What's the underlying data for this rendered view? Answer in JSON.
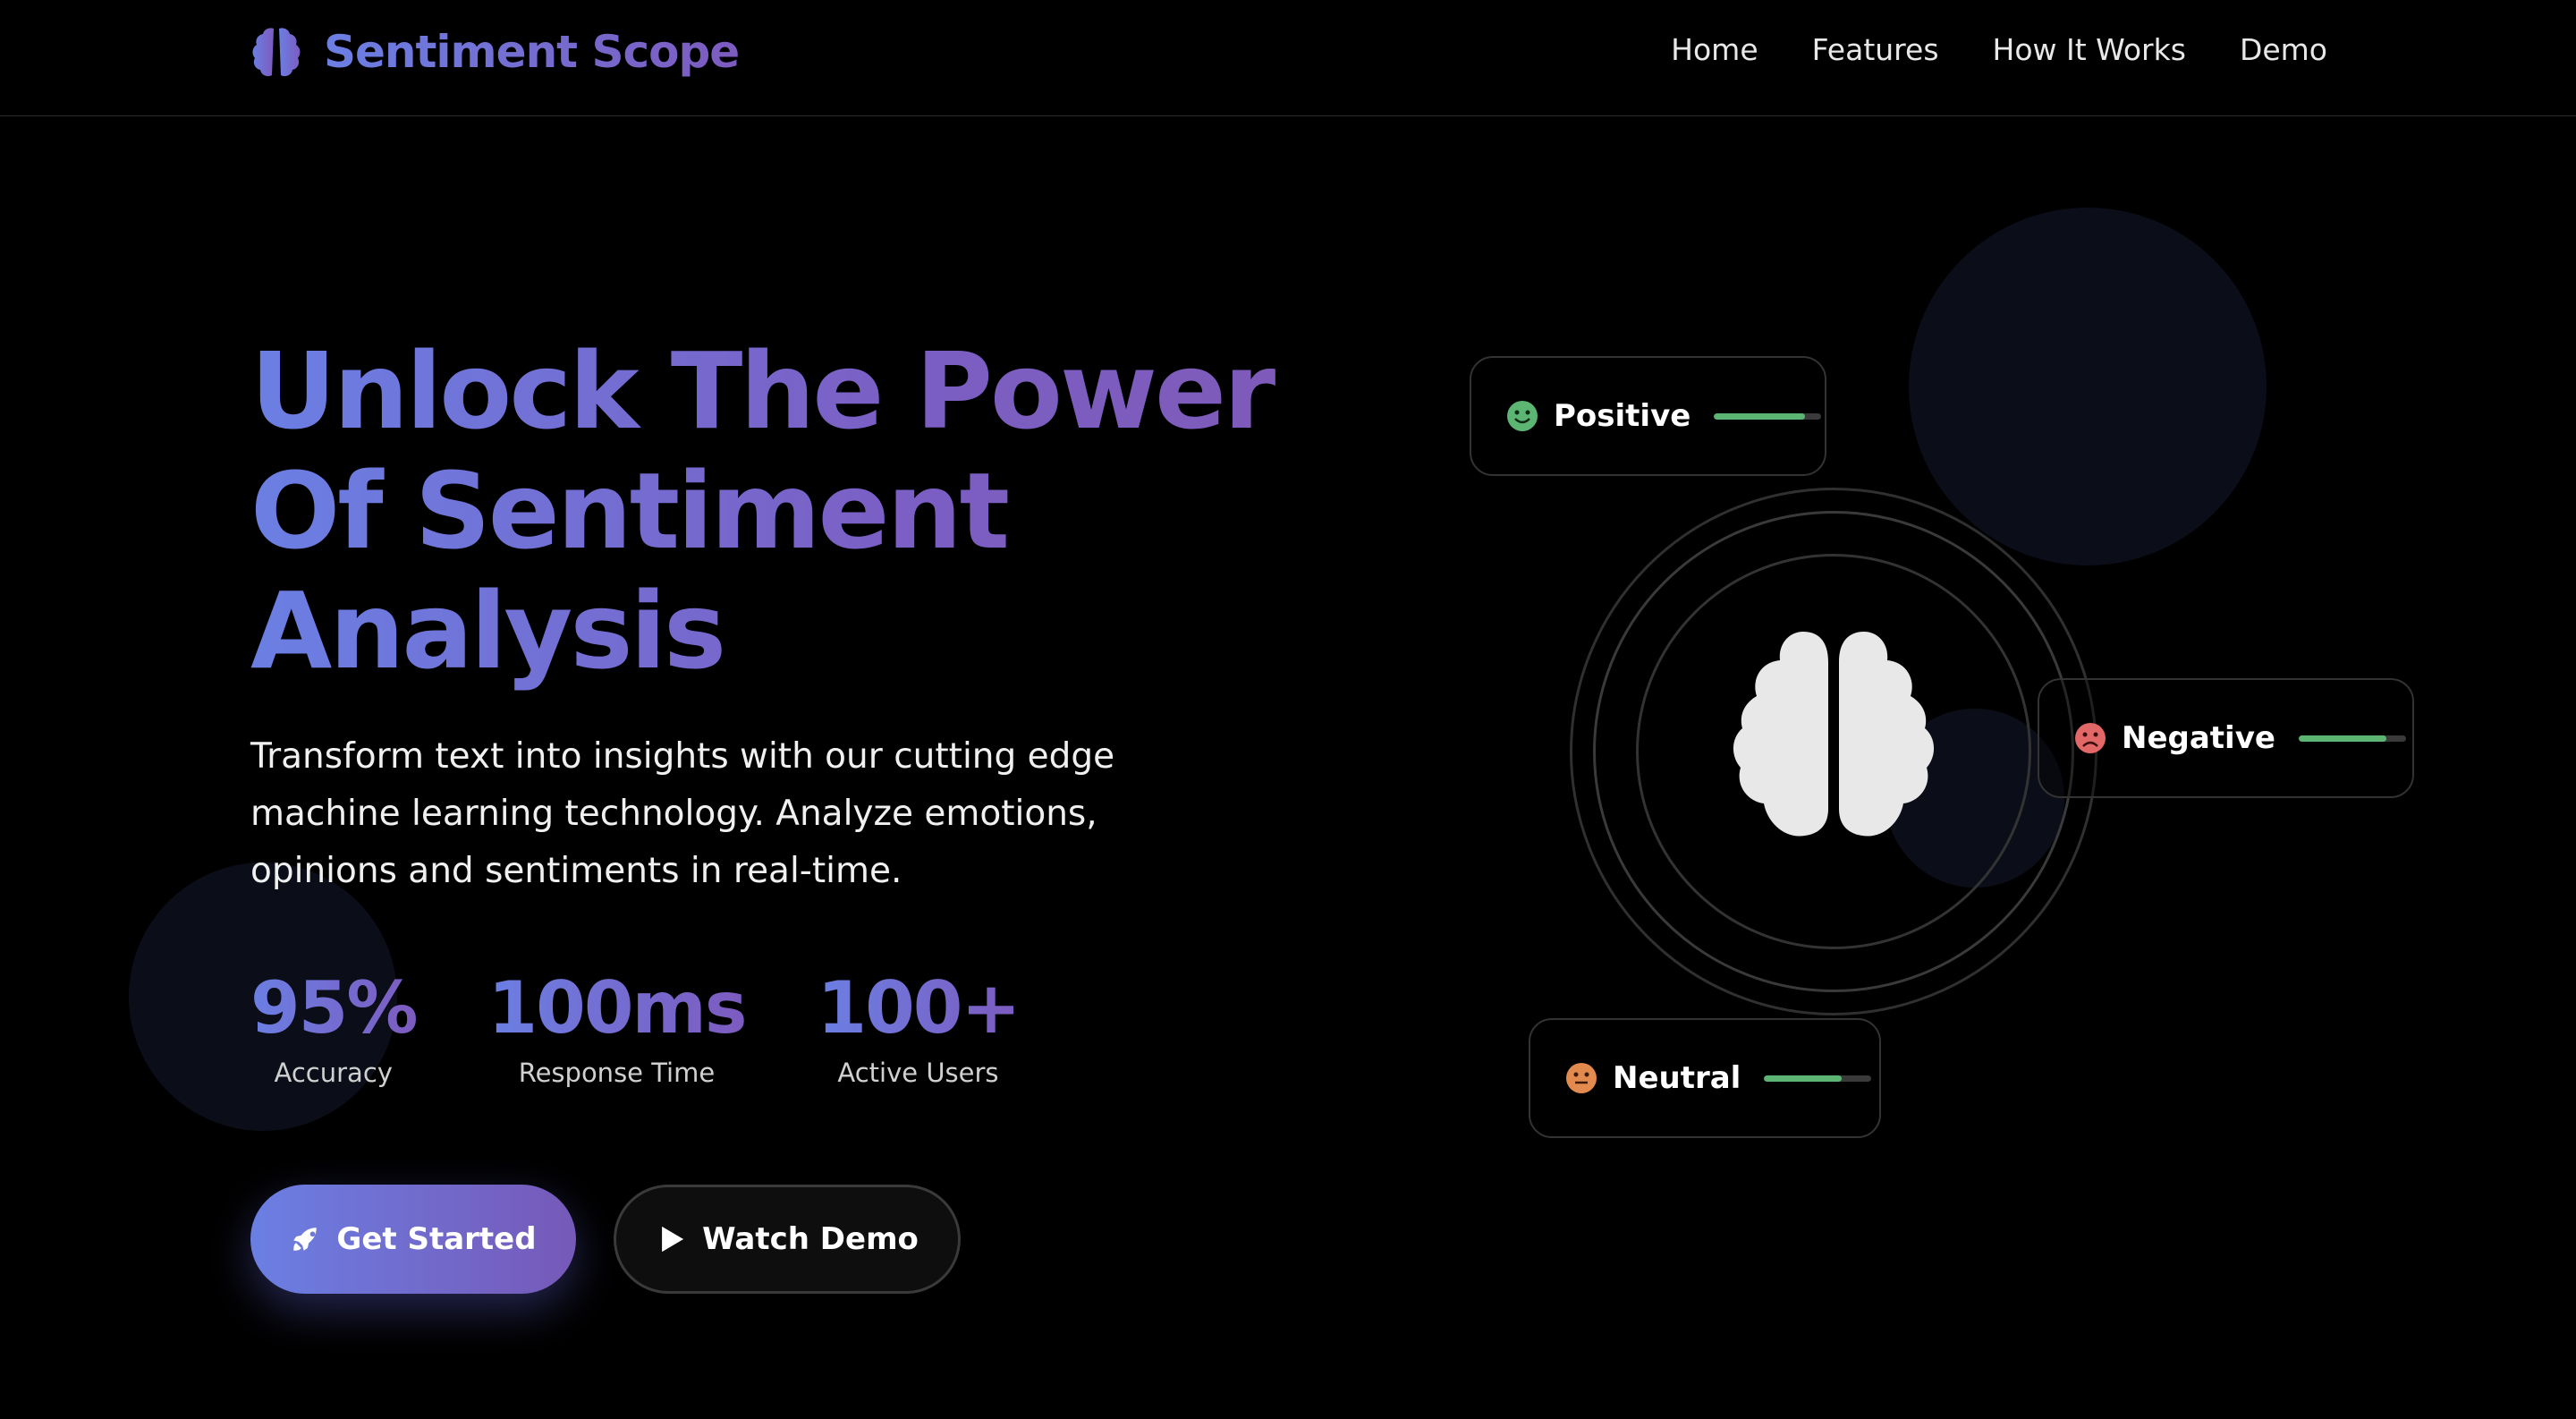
{
  "brand": {
    "name": "Sentiment Scope",
    "icon": "brain-icon",
    "gradient": [
      "#6b7fe3",
      "#7d5bbf"
    ]
  },
  "nav": {
    "links": [
      "Home",
      "Features",
      "How It Works",
      "Demo"
    ]
  },
  "hero": {
    "title_lines": [
      "Unlock The Power",
      "Of Sentiment",
      "Analysis"
    ],
    "subtitle": "Transform text into insights with our cutting edge machine learning technology. Analyze emotions, opinions and sentiments in real-time."
  },
  "stats": [
    {
      "value": "95%",
      "label": "Accuracy"
    },
    {
      "value": "100ms",
      "label": "Response Time"
    },
    {
      "value": "100+",
      "label": "Active Users"
    }
  ],
  "buttons": {
    "primary": {
      "label": "Get Started",
      "icon": "rocket-icon"
    },
    "secondary": {
      "label": "Watch Demo",
      "icon": "play-icon"
    }
  },
  "sentiments": [
    {
      "label": "Positive",
      "icon": "smile-face-icon",
      "color": "#5cb572",
      "level": 0.85
    },
    {
      "label": "Negative",
      "icon": "frown-face-icon",
      "color": "#e26868",
      "level": 0.82
    },
    {
      "label": "Neutral",
      "icon": "neutral-face-icon",
      "color": "#e38a4e",
      "level": 0.72
    }
  ],
  "colors": {
    "background": "#000000",
    "accent": "#6b7fe3",
    "bar": "#5cb572"
  }
}
